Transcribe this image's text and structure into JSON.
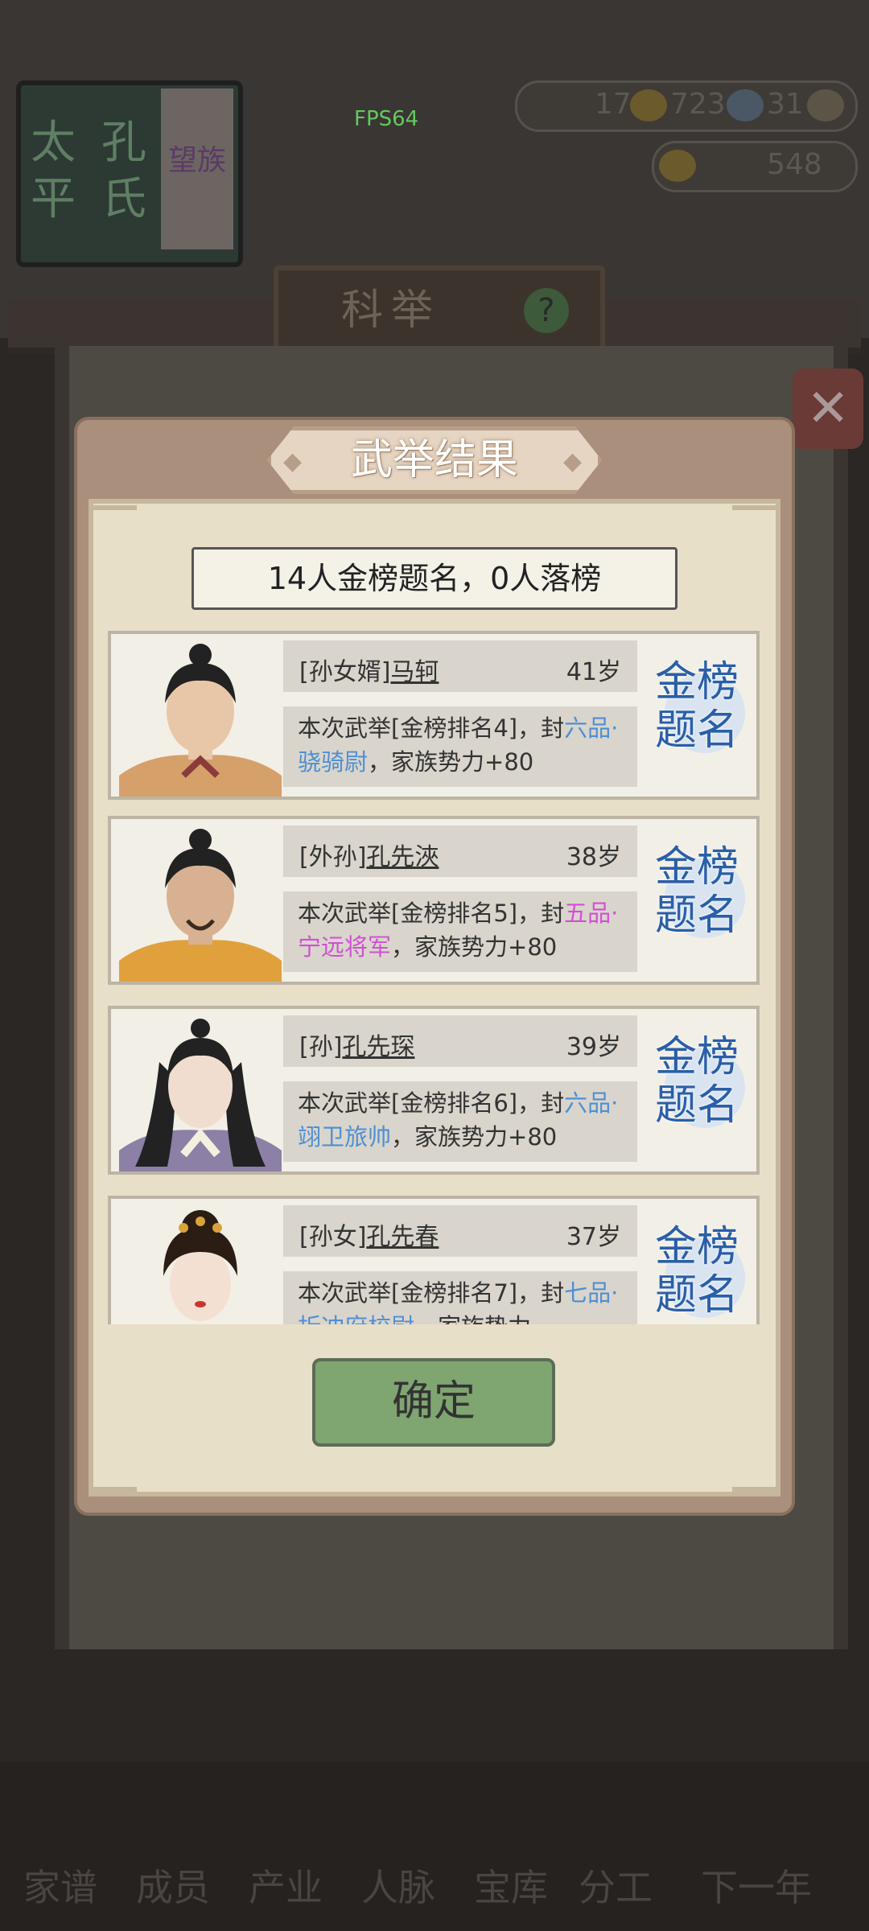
{
  "hud": {
    "fps": "FPS64",
    "resource1": "17",
    "resource2": "723",
    "resource3": "31",
    "gold": "548",
    "clan_chars_left": [
      "太",
      "平"
    ],
    "clan_chars_mid": [
      "孔",
      "氏"
    ],
    "clan_side": "望族"
  },
  "screen_title": "科举",
  "dialog": {
    "title": "武举结果",
    "summary": "14人金榜题名，0人落榜",
    "stamp": [
      "金榜",
      "题名"
    ],
    "confirm_label": "确定",
    "results": [
      {
        "relation": "[孙女婿]",
        "name": "马轲",
        "age": "41岁",
        "desc_pre": "本次武举[金榜排名4]，封",
        "rank": "六品·骁骑尉",
        "rank_color": "#4f8fd3",
        "desc_post": "，家族势力+80"
      },
      {
        "relation": "[外孙]",
        "name": "孔先浹",
        "age": "38岁",
        "desc_pre": "本次武举[金榜排名5]，封",
        "rank": "五品·宁远将军",
        "rank_color": "#d24fd6",
        "desc_post": "，家族势力+80"
      },
      {
        "relation": "[孙]",
        "name": "孔先琛",
        "age": "39岁",
        "desc_pre": "本次武举[金榜排名6]，封",
        "rank": "六品·翊卫旅帅",
        "rank_color": "#4f8fd3",
        "desc_post": "，家族势力+80"
      },
      {
        "relation": "[孙女]",
        "name": "孔先春",
        "age": "37岁",
        "desc_pre": "本次武举[金榜排名7]，封",
        "rank": "七品·折冲府校尉",
        "rank_color": "#4f8fd3",
        "desc_post": "，家族势力"
      }
    ]
  },
  "bottom_nav": [
    "家谱",
    "成员",
    "产业",
    "人脉",
    "宝库",
    "分工",
    "下一年"
  ],
  "colors": {
    "accent_green": "#7fa571",
    "rank_blue": "#4f8fd3",
    "rank_pink": "#d24fd6"
  }
}
